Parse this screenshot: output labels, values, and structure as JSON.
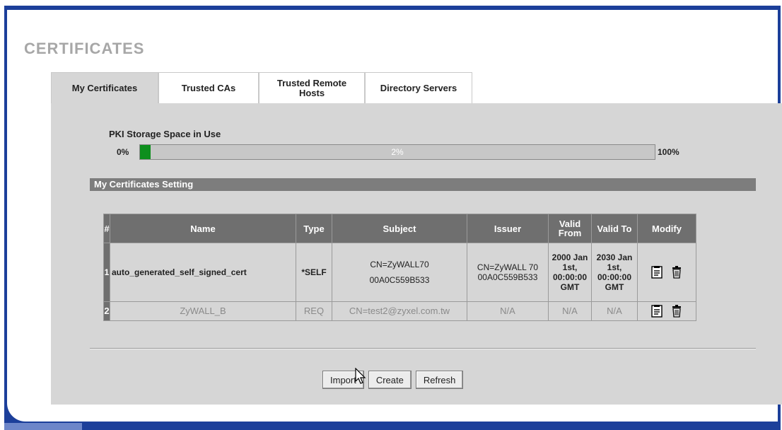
{
  "page": {
    "title": "CERTIFICATES"
  },
  "tabs": [
    {
      "label": "My Certificates",
      "active": true
    },
    {
      "label": "Trusted CAs",
      "active": false
    },
    {
      "label": "Trusted Remote Hosts",
      "active": false
    },
    {
      "label": "Directory Servers",
      "active": false
    }
  ],
  "storage": {
    "label": "PKI Storage Space in Use",
    "min_label": "0%",
    "max_label": "100%",
    "usage_text": "2%",
    "usage_percent": 2,
    "fill_color": "#0d8f1d"
  },
  "section": {
    "title": "My Certificates Setting"
  },
  "table": {
    "headers": [
      "#",
      "Name",
      "Type",
      "Subject",
      "Issuer",
      "Valid From",
      "Valid To",
      "Modify"
    ],
    "rows": [
      {
        "num": "1",
        "name": "auto_generated_self_signed_cert",
        "type": "*SELF",
        "subject_line1": "CN=ZyWALL70",
        "subject_line2": "00A0C559B533",
        "issuer": "CN=ZyWALL 70 00A0C559B533",
        "valid_from": "2000 Jan 1st, 00:00:00 GMT",
        "valid_to": "2030 Jan 1st, 00:00:00 GMT"
      },
      {
        "num": "2",
        "name": "ZyWALL_B",
        "type": "REQ",
        "subject_line1": "CN=test2@zyxel.com.tw",
        "subject_line2": "",
        "issuer": "N/A",
        "valid_from": "N/A",
        "valid_to": "N/A"
      }
    ],
    "icons": [
      "edit-icon",
      "delete-icon"
    ]
  },
  "buttons": {
    "import": "Import",
    "create": "Create",
    "refresh": "Refresh"
  },
  "colors": {
    "frame": "#1c3f9a",
    "panel": "#d6d6d6",
    "header": "#6f6f6f",
    "progress": "#0d8f1d"
  }
}
